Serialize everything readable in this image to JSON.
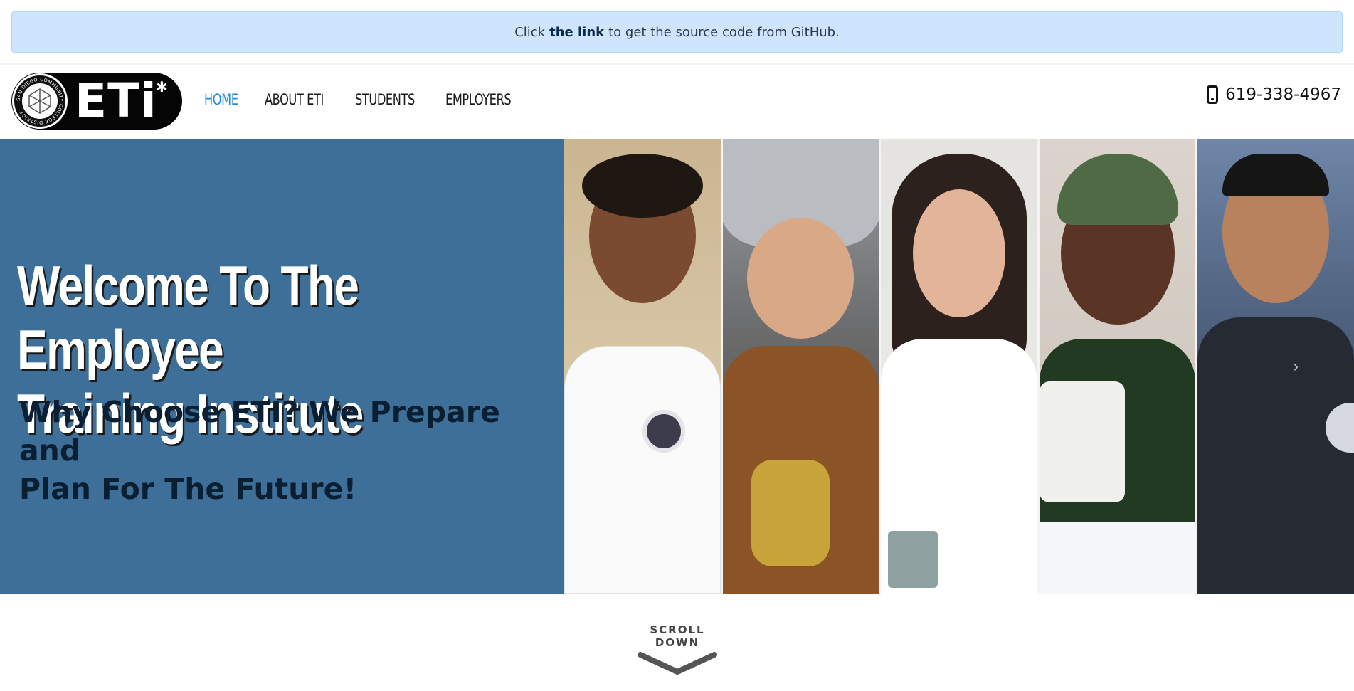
{
  "banner": {
    "prefix": "Click",
    "link": "the link",
    "suffix": "to get the source code from GitHub."
  },
  "logo": {
    "text": "ETi",
    "seal_text": "SAN DIEGO COMMUNITY COLLEGE DISTRICT"
  },
  "nav": {
    "items": [
      {
        "label": "HOME",
        "active": true
      },
      {
        "label": "ABOUT ETI",
        "active": false
      },
      {
        "label": "STUDENTS",
        "active": false
      },
      {
        "label": "EMPLOYERS",
        "active": false
      }
    ]
  },
  "contact": {
    "phone": "619-338-4967",
    "icon": "mobile-phone-icon"
  },
  "hero": {
    "title_line1": "Welcome To The Employee",
    "title_line2": "Training Institute",
    "subtitle_line1": "Why Choose ETI? We Prepare and",
    "subtitle_line2": "Plan For The Future!",
    "panels": [
      "chef-student-photo",
      "welder-student-photo",
      "student-photo",
      "sewing-student-photo",
      "student-photo"
    ]
  },
  "scroll": {
    "label": "SCROLL DOWN",
    "icon": "chevron-down-icon"
  },
  "colors": {
    "banner_bg": "#cfe5fd",
    "hero_blue": "#3d6f98",
    "nav_active": "#1b8fd8",
    "subtitle": "#0b1f33"
  }
}
